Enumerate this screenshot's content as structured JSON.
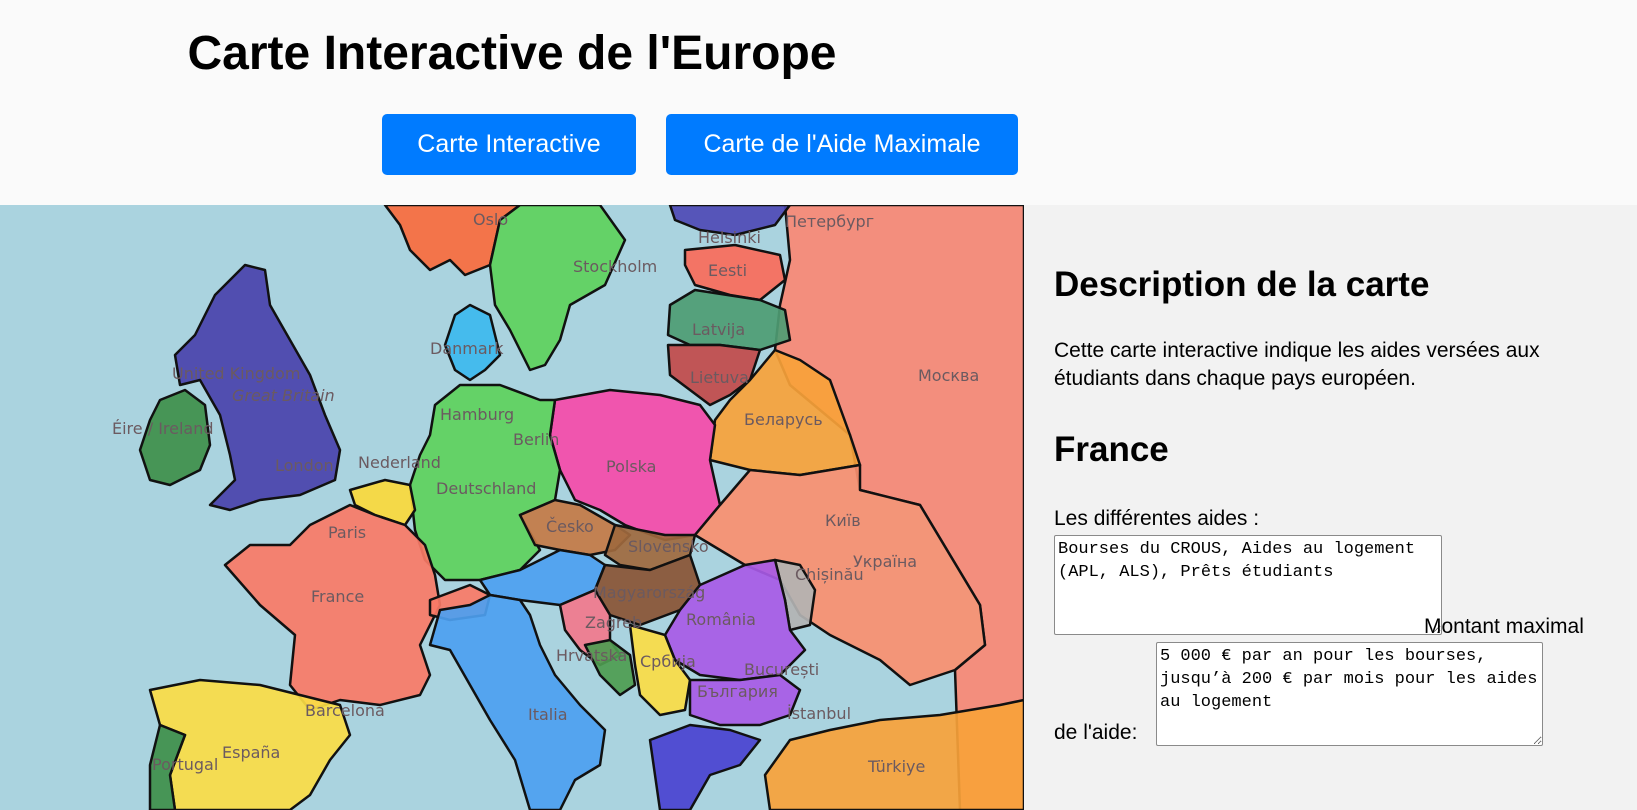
{
  "header": {
    "title": "Carte Interactive de l'Europe",
    "buttons": [
      "Carte Interactive",
      "Carte de l'Aide Maximale"
    ]
  },
  "colors": {
    "button": "#007bff",
    "sea": "#aad3df",
    "sidebar": "#f2f2f2"
  },
  "map": {
    "labels": {
      "oslo": "Oslo",
      "stockholm": "Stockholm",
      "helsinki": "Helsinki",
      "peterburg": "Петербург",
      "eesti": "Eesti",
      "latvija": "Latvija",
      "lietuva": "Lietuva",
      "moskva": "Москва",
      "united_kingdom": "United Kingdom",
      "great_britain": "Great Britain",
      "eire": "Éire / Ireland",
      "london": "London",
      "danmark": "Danmark",
      "hamburg": "Hamburg",
      "berlin": "Berlin",
      "nederland": "Nederland",
      "deutschland": "Deutschland",
      "polska": "Polska",
      "belarus": "Беларусь",
      "paris": "Paris",
      "france": "France",
      "cesko": "Česko",
      "slovensko": "Slovensko",
      "kyiv": "Київ",
      "ukraina": "Україна",
      "magyarorszag": "Magyarország",
      "chisinau": "Chișinău",
      "romania": "România",
      "zagreb": "Zagreb",
      "hrvatska": "Hrvatska",
      "srbija": "Србија",
      "bucuresti": "București",
      "balgaria": "България",
      "barcelona": "Barcelona",
      "espana": "España",
      "portugal": "Portugal",
      "italia": "Italia",
      "istanbul": "İstanbul",
      "turkiye": "Türkiye"
    }
  },
  "sidebar": {
    "description_title": "Description de la carte",
    "description_text": "Cette carte interactive indique les aides versées aux étudiants dans chaque pays européen.",
    "country_name": "France",
    "aids_label": "Les différentes aides :",
    "aids_value": "Bourses du CROUS, Aides au logement (APL, ALS), Prêts étudiants",
    "amount_label_1": "Montant maximal",
    "amount_label_2": "de l'aide:",
    "amount_value": "5 000 € par an pour les bourses, jusqu’à 200 € par mois pour les aides au logement"
  }
}
